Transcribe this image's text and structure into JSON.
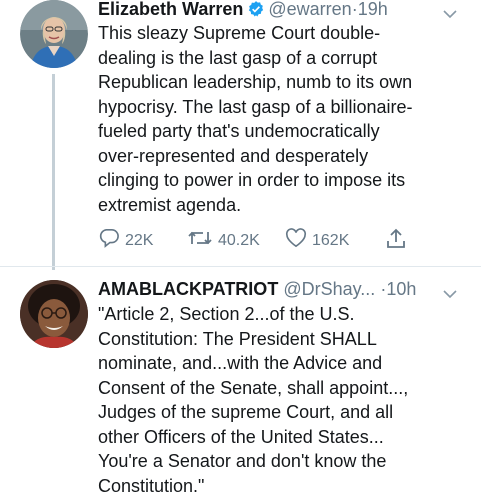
{
  "tweets": [
    {
      "name": "Elizabeth Warren",
      "verified": true,
      "handle": "@ewarren",
      "separator": "·",
      "time": "19h",
      "lines": [
        "This sleazy Supreme Court double-",
        "dealing is the last gasp of a corrupt",
        "Republican leadership, numb to its own",
        "hypocrisy. The last gasp of a billionaire-",
        "fueled party that's undemocratically",
        "over-represented and desperately",
        "clinging to power in order to impose its",
        "extremist agenda."
      ],
      "replies": "22K",
      "retweets": "40.2K",
      "likes": "162K"
    },
    {
      "name": "AMABLACKPATRIOT",
      "verified": false,
      "handle": "@DrShay...",
      "separator": "·",
      "time": "10h",
      "lines": [
        "\"Article 2, Section 2...of the U.S.",
        "Constitution: The President SHALL",
        "nominate, and...with the Advice and",
        "Consent of the Senate, shall appoint...,",
        "Judges of the supreme Court, and all",
        "other Officers of the United States...",
        "You're a Senator and don't know the",
        "Constitution.\""
      ]
    }
  ],
  "colors": {
    "accent": "#1da1f2",
    "secondary_text": "#657786",
    "primary_text": "#14171a",
    "thread_line": "#c4cfd6"
  },
  "icons": {
    "reply": "reply-icon",
    "retweet": "retweet-icon",
    "like": "like-icon",
    "share": "share-icon",
    "menu": "chevron-down-icon",
    "verified": "verified-badge-icon"
  }
}
